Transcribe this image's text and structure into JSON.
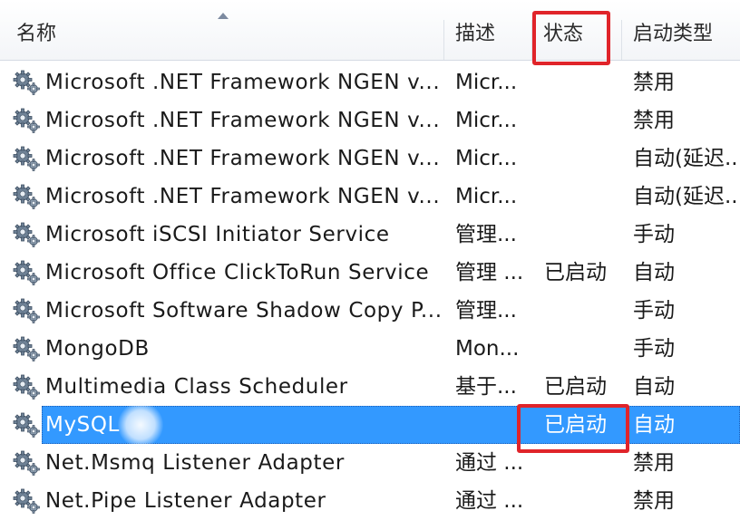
{
  "columns": {
    "name": "名称",
    "description": "描述",
    "status": "状态",
    "startup_type": "启动类型"
  },
  "sort": {
    "column": "name",
    "direction": "ascending"
  },
  "rows": [
    {
      "name": "Microsoft .NET Framework NGEN v...",
      "description": "Micr...",
      "status": "",
      "startup_type": "禁用"
    },
    {
      "name": "Microsoft .NET Framework NGEN v...",
      "description": "Micr...",
      "status": "",
      "startup_type": "禁用"
    },
    {
      "name": "Microsoft .NET Framework NGEN v...",
      "description": "Micr...",
      "status": "",
      "startup_type": "自动(延迟..."
    },
    {
      "name": "Microsoft .NET Framework NGEN v...",
      "description": "Micr...",
      "status": "",
      "startup_type": "自动(延迟..."
    },
    {
      "name": "Microsoft iSCSI Initiator Service",
      "description": "管理...",
      "status": "",
      "startup_type": "手动"
    },
    {
      "name": "Microsoft Office ClickToRun Service",
      "description": "管理 ...",
      "status": "已启动",
      "startup_type": "自动"
    },
    {
      "name": "Microsoft Software Shadow Copy P...",
      "description": "管理...",
      "status": "",
      "startup_type": "手动"
    },
    {
      "name": "MongoDB",
      "description": "Mon...",
      "status": "",
      "startup_type": "手动"
    },
    {
      "name": "Multimedia Class Scheduler",
      "description": "基于...",
      "status": "已启动",
      "startup_type": "自动"
    },
    {
      "name": "MySQL",
      "description": "",
      "status": "已启动",
      "startup_type": "自动",
      "selected": true
    },
    {
      "name": "Net.Msmq Listener Adapter",
      "description": "通过 ...",
      "status": "",
      "startup_type": "禁用"
    },
    {
      "name": "Net.Pipe Listener Adapter",
      "description": "通过 ...",
      "status": "",
      "startup_type": "禁用"
    }
  ],
  "icons": {
    "service": "service-gear-icon"
  },
  "colors": {
    "selection": "#3399ff",
    "annotation_box": "#e0242a",
    "header_bg": "#f3f5f8"
  }
}
